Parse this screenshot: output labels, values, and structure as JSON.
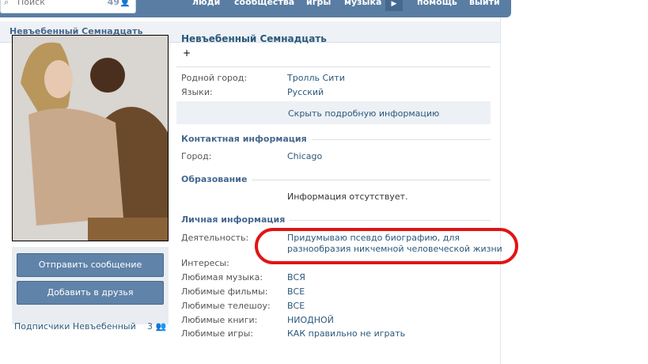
{
  "search": {
    "placeholder": "Поиск",
    "count": "49"
  },
  "nav": {
    "items": [
      "люди",
      "сообщества",
      "игры",
      "музыка",
      "помощь",
      "выйти"
    ]
  },
  "page": {
    "header_title": "Невъебенный Семнадцать"
  },
  "profile": {
    "name": "Невъебенный Семнадцать",
    "status": "+",
    "hometown_label": "Родной город:",
    "hometown_value": "Тролль Сити",
    "languages_label": "Языки:",
    "languages_value": "Русский",
    "hide_details": "Скрыть подробную информацию",
    "contact_title": "Контактная информация",
    "city_label": "Город:",
    "city_value": "Chicago",
    "education_title": "Образование",
    "education_value": "Информация отсутствует.",
    "personal_title": "Личная информация",
    "activity_label": "Деятельность:",
    "activity_line1": "Придумываю псевдо биографию, для",
    "activity_line2": "разнообразия никчемной человеческой жизни",
    "interests_label": "Интересы:",
    "music_label": "Любимая музыка:",
    "music_value": "ВСЯ",
    "films_label": "Любимые фильмы:",
    "films_value": "ВСЕ",
    "tv_label": "Любимые телешоу:",
    "tv_value": "ВСЕ",
    "books_label": "Любимые книги:",
    "books_value": "НИОДНОЙ",
    "games_label": "Любимые игры:",
    "games_value": "КАК правильно не играть"
  },
  "actions": {
    "send_message": "Отправить сообщение",
    "add_friend": "Добавить в друзья"
  },
  "subscribers": {
    "label": "Подписчики Невъебенный",
    "count": "3"
  },
  "colors": {
    "header": "#597da3",
    "link": "#2b587a",
    "button": "#6083a9",
    "highlight": "#e01515"
  },
  "icons": {
    "search": "search-icon",
    "user": "user-icon",
    "arrow": "play-arrow-icon"
  }
}
